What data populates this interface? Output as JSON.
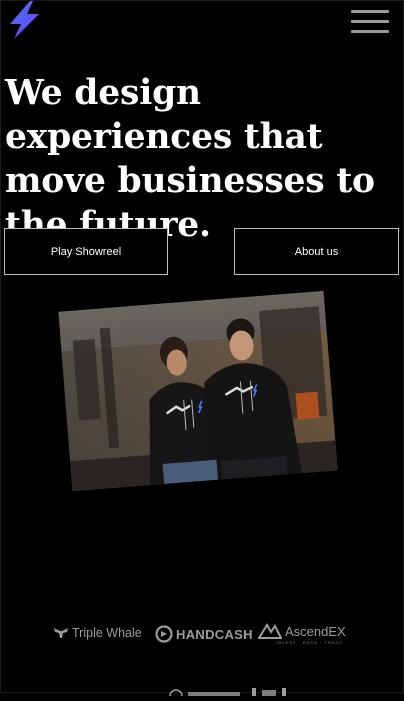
{
  "header": {
    "logo_icon": "lightning-bolt-icon",
    "menu_icon": "hamburger-menu-icon"
  },
  "hero": {
    "headline": "We design experiences that move businesses to the future."
  },
  "buttons": {
    "play_showreel": "Play Showreel",
    "about_us": "About us"
  },
  "photo": {
    "description_icon": "team-photo"
  },
  "clients": {
    "logos": [
      {
        "name": "Triple Whale",
        "icon": "whale-tail-icon"
      },
      {
        "name": "HANDCASH",
        "icon": "handcash-icon"
      },
      {
        "name": "AscendEX",
        "icon": "ascendex-icon",
        "tagline": "INVEST · EARN · TRADE"
      }
    ]
  },
  "colors": {
    "background": "#000000",
    "text": "#ffffff",
    "button_border": "#bdbdbd",
    "logo_gray": "#9c9c9c",
    "bolt_blue": "#3d6bff",
    "bolt_violet": "#8a4dff"
  }
}
